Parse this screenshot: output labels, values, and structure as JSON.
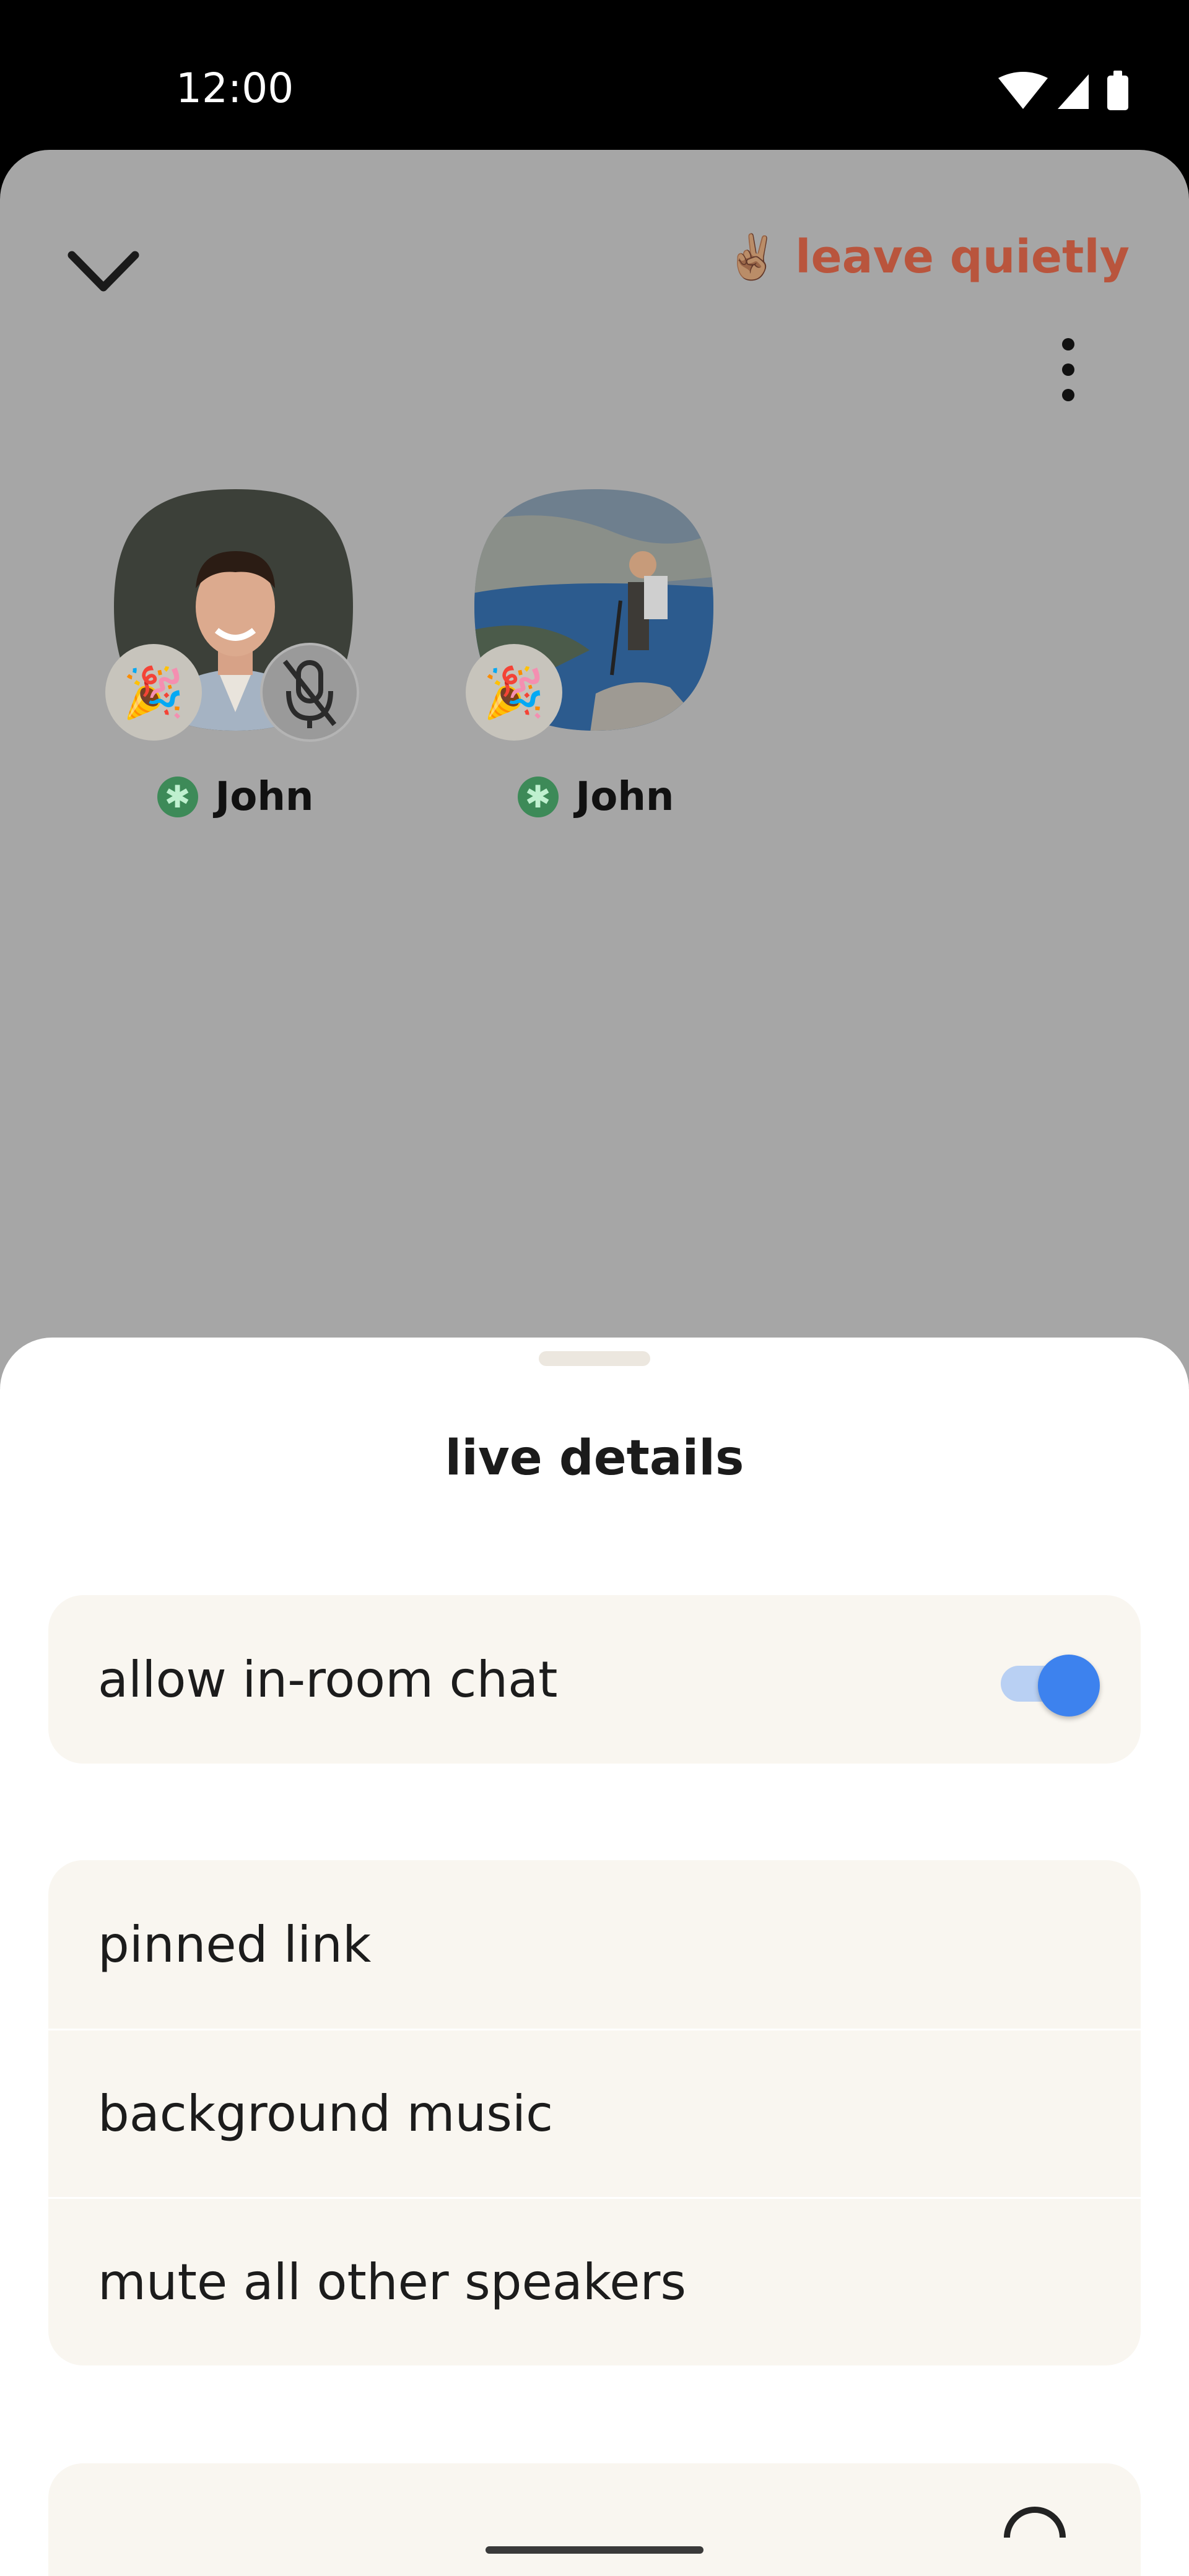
{
  "status_bar": {
    "time": "12:00"
  },
  "room": {
    "leave": {
      "emoji": "✌🏽",
      "label": "leave quietly"
    },
    "speakers": [
      {
        "name": "John",
        "reaction_emoji": "🎉",
        "muted": true,
        "photo": "man-portrait"
      },
      {
        "name": "John",
        "reaction_emoji": "🎉",
        "muted": false,
        "photo": "hiker-landscape"
      }
    ]
  },
  "sheet": {
    "title": "live details",
    "chat_toggle": {
      "label": "allow in-room chat",
      "enabled": true
    },
    "options": [
      {
        "label": "pinned link"
      },
      {
        "label": "background music"
      },
      {
        "label": "mute all other speakers"
      }
    ]
  },
  "colors": {
    "accent_leave": "#b9553d",
    "toggle_on": "#3d82ee",
    "card_bg": "#f9f6f0",
    "online_dot": "#3d8a58"
  }
}
